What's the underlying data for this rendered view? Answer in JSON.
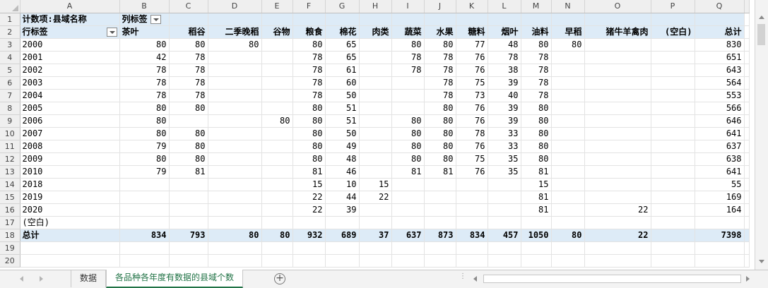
{
  "sheet": {
    "col_letters": [
      "A",
      "B",
      "C",
      "D",
      "E",
      "F",
      "G",
      "H",
      "I",
      "J",
      "K",
      "L",
      "M",
      "N",
      "O",
      "P",
      "Q"
    ],
    "row_numbers": [
      "1",
      "2",
      "3",
      "4",
      "5",
      "6",
      "7",
      "8",
      "9",
      "10",
      "11",
      "12",
      "13",
      "14",
      "15",
      "16",
      "17",
      "18",
      "19",
      "20"
    ],
    "pivot": {
      "value_field": "计数项:县域名称",
      "col_labels": "列标签",
      "row_labels": "行标签",
      "categories": [
        "茶叶",
        "稻谷",
        "二季晚稻",
        "谷物",
        "粮食",
        "棉花",
        "肉类",
        "蔬菜",
        "水果",
        "糖料",
        "烟叶",
        "油料",
        "早稻",
        "猪牛羊禽肉",
        "(空白)",
        "总计"
      ],
      "rows": [
        {
          "label": "2000",
          "cells": [
            "80",
            "80",
            "80",
            "",
            "80",
            "65",
            "",
            "80",
            "80",
            "77",
            "48",
            "80",
            "80",
            "",
            "",
            "830"
          ]
        },
        {
          "label": "2001",
          "cells": [
            "42",
            "78",
            "",
            "",
            "78",
            "65",
            "",
            "78",
            "78",
            "76",
            "78",
            "78",
            "",
            "",
            "",
            "651"
          ]
        },
        {
          "label": "2002",
          "cells": [
            "78",
            "78",
            "",
            "",
            "78",
            "61",
            "",
            "78",
            "78",
            "76",
            "38",
            "78",
            "",
            "",
            "",
            "643"
          ]
        },
        {
          "label": "2003",
          "cells": [
            "78",
            "78",
            "",
            "",
            "78",
            "60",
            "",
            "",
            "78",
            "75",
            "39",
            "78",
            "",
            "",
            "",
            "564"
          ]
        },
        {
          "label": "2004",
          "cells": [
            "78",
            "78",
            "",
            "",
            "78",
            "50",
            "",
            "",
            "78",
            "73",
            "40",
            "78",
            "",
            "",
            "",
            "553"
          ]
        },
        {
          "label": "2005",
          "cells": [
            "80",
            "80",
            "",
            "",
            "80",
            "51",
            "",
            "",
            "80",
            "76",
            "39",
            "80",
            "",
            "",
            "",
            "566"
          ]
        },
        {
          "label": "2006",
          "cells": [
            "80",
            "",
            "",
            "80",
            "80",
            "51",
            "",
            "80",
            "80",
            "76",
            "39",
            "80",
            "",
            "",
            "",
            "646"
          ]
        },
        {
          "label": "2007",
          "cells": [
            "80",
            "80",
            "",
            "",
            "80",
            "50",
            "",
            "80",
            "80",
            "78",
            "33",
            "80",
            "",
            "",
            "",
            "641"
          ]
        },
        {
          "label": "2008",
          "cells": [
            "79",
            "80",
            "",
            "",
            "80",
            "49",
            "",
            "80",
            "80",
            "76",
            "33",
            "80",
            "",
            "",
            "",
            "637"
          ]
        },
        {
          "label": "2009",
          "cells": [
            "80",
            "80",
            "",
            "",
            "80",
            "48",
            "",
            "80",
            "80",
            "75",
            "35",
            "80",
            "",
            "",
            "",
            "638"
          ]
        },
        {
          "label": "2010",
          "cells": [
            "79",
            "81",
            "",
            "",
            "81",
            "46",
            "",
            "81",
            "81",
            "76",
            "35",
            "81",
            "",
            "",
            "",
            "641"
          ]
        },
        {
          "label": "2018",
          "cells": [
            "",
            "",
            "",
            "",
            "15",
            "10",
            "15",
            "",
            "",
            "",
            "",
            "15",
            "",
            "",
            "",
            "55"
          ]
        },
        {
          "label": "2019",
          "cells": [
            "",
            "",
            "",
            "",
            "22",
            "44",
            "22",
            "",
            "",
            "",
            "",
            "81",
            "",
            "",
            "",
            "169"
          ]
        },
        {
          "label": "2020",
          "cells": [
            "",
            "",
            "",
            "",
            "22",
            "39",
            "",
            "",
            "",
            "",
            "",
            "81",
            "",
            "22",
            "",
            "164"
          ]
        },
        {
          "label": "(空白)",
          "cells": [
            "",
            "",
            "",
            "",
            "",
            "",
            "",
            "",
            "",
            "",
            "",
            "",
            "",
            "",
            "",
            ""
          ]
        }
      ],
      "total": {
        "label": "总计",
        "cells": [
          "834",
          "793",
          "80",
          "80",
          "932",
          "689",
          "37",
          "637",
          "873",
          "834",
          "457",
          "1050",
          "80",
          "22",
          "",
          "7398"
        ]
      }
    }
  },
  "tabs": [
    {
      "label": "数据"
    },
    {
      "label": "各品种各年度有数据的县域个数"
    }
  ],
  "add_sheet_label": "+",
  "colors": {
    "pivot_header_bg": "#ddebf7",
    "active_tab": "#217346",
    "chrome_bg": "#efefef"
  }
}
